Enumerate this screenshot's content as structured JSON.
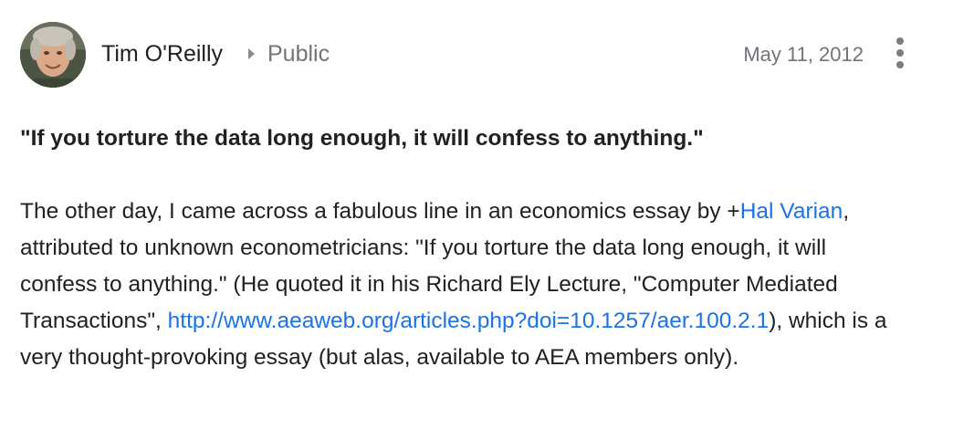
{
  "post": {
    "author": "Tim O'Reilly",
    "visibility": "Public",
    "date": "May 11, 2012",
    "more_icon": "more-vert-icon",
    "quote": "\"If you torture the data long enough, it will confess to anything.\"",
    "para": {
      "t1": "The other day, I came across a fabulous line in an economics essay by +",
      "mention": "Hal Varian",
      "t2": ", attributed to unknown econometricians: \"If you torture the data long enough, it will confess to anything.\" (He quoted it in his Richard Ely Lecture, \"Computer Mediated Transactions\", ",
      "link": "http://www.aeaweb.org/articles.php?doi=10.1257/aer.100.2.1",
      "t3": "), which is a very thought-provoking essay (but alas, available to AEA members only)."
    }
  },
  "colors": {
    "link": "#1a73e8",
    "text": "#202124",
    "muted": "#70757a"
  }
}
